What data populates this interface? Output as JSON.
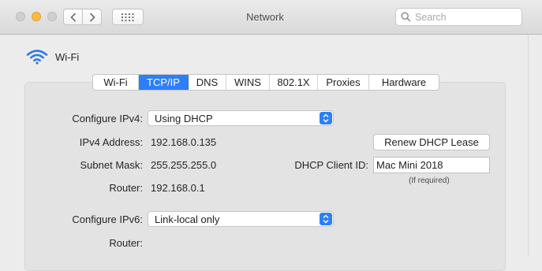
{
  "window": {
    "title": "Network"
  },
  "search": {
    "placeholder": "Search"
  },
  "interface": {
    "name": "Wi-Fi"
  },
  "tabs": [
    {
      "label": "Wi-Fi"
    },
    {
      "label": "TCP/IP"
    },
    {
      "label": "DNS"
    },
    {
      "label": "WINS"
    },
    {
      "label": "802.1X"
    },
    {
      "label": "Proxies"
    },
    {
      "label": "Hardware"
    }
  ],
  "active_tab": "TCP/IP",
  "ipv4": {
    "configure_label": "Configure IPv4:",
    "configure_value": "Using DHCP",
    "address_label": "IPv4 Address:",
    "address_value": "192.168.0.135",
    "subnet_label": "Subnet Mask:",
    "subnet_value": "255.255.255.0",
    "router_label": "Router:",
    "router_value": "192.168.0.1"
  },
  "dhcp": {
    "renew_label": "Renew DHCP Lease",
    "client_id_label": "DHCP Client ID:",
    "client_id_value": "Mac Mini 2018",
    "client_id_hint": "(If required)"
  },
  "ipv6": {
    "configure_label": "Configure IPv6:",
    "configure_value": "Link-local only",
    "router_label": "Router:"
  },
  "colors": {
    "accent": "#2d7ff9",
    "wifi_icon": "#2f7ae5",
    "minimize_light": "#fdbc40"
  },
  "icons": {
    "back": "chevron-left-icon",
    "forward": "chevron-right-icon",
    "show_all": "grid-icon",
    "search": "search-icon",
    "wifi": "wifi-icon",
    "popup": "chevron-updown-icon"
  }
}
